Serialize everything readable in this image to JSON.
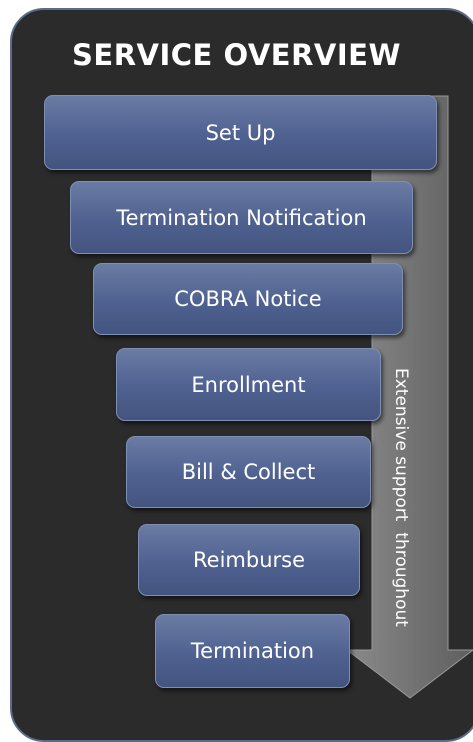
{
  "title": "SERVICE OVERVIEW",
  "steps": [
    {
      "label": "Set Up"
    },
    {
      "label": "Termination Notification"
    },
    {
      "label": "COBRA Notice"
    },
    {
      "label": "Enrollment"
    },
    {
      "label": "Bill & Collect"
    },
    {
      "label": "Reimburse"
    },
    {
      "label": "Termination"
    }
  ],
  "arrow_label": "Extensive support  throughout",
  "colors": {
    "panel_background": "#2b2b2b",
    "panel_border": "#5b6b8c",
    "step_fill": "#4f6190",
    "arrow_fill": "#6e6e6e"
  }
}
